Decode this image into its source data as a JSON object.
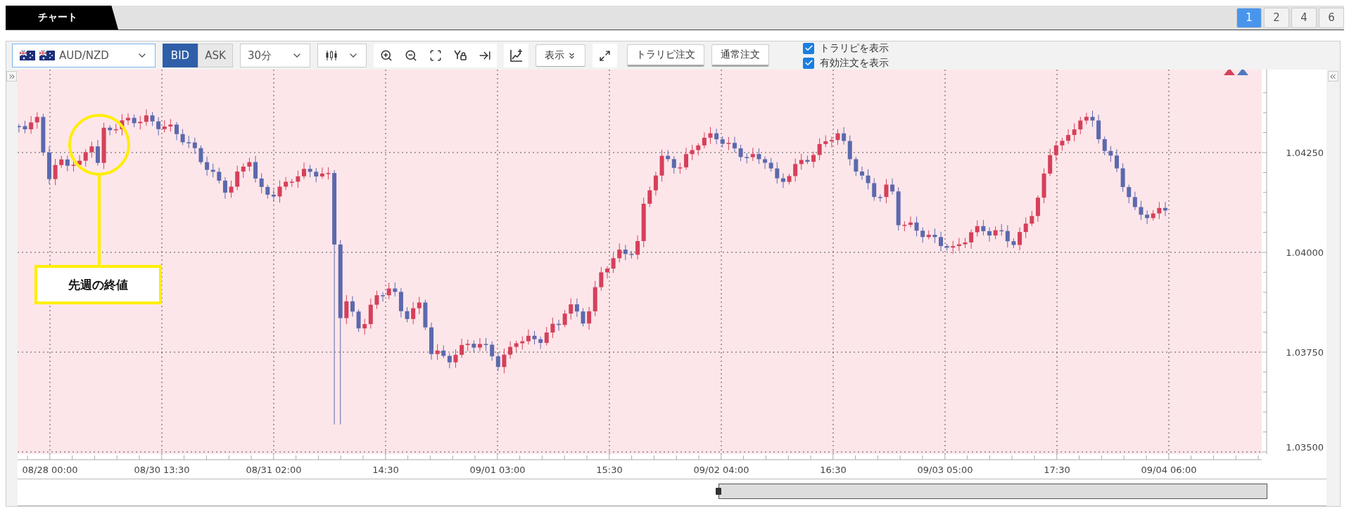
{
  "tabs": [
    {
      "label": "チャート",
      "selected": true
    }
  ],
  "layout_buttons": [
    {
      "label": "1",
      "selected": true
    },
    {
      "label": "2",
      "selected": false
    },
    {
      "label": "4",
      "selected": false
    },
    {
      "label": "6",
      "selected": false
    }
  ],
  "toolbar": {
    "currency_pair": "AUD/NZD",
    "price_types": [
      {
        "label": "BID",
        "selected": true
      },
      {
        "label": "ASK",
        "selected": false
      }
    ],
    "timeframe": "30分",
    "display_button": "表示",
    "order_buttons": [
      "トラリピ注文",
      "通常注文"
    ],
    "checkboxes": [
      {
        "label": "トラリピを表示",
        "checked": true
      },
      {
        "label": "有効注文を表示",
        "checked": true
      }
    ]
  },
  "chart": {
    "y_axis_labels": [
      "1.04250",
      "1.04000",
      "1.03750",
      "1.03500"
    ],
    "x_axis_labels": [
      "08/28 00:00",
      "08/30 13:30",
      "08/31 02:00",
      "14:30",
      "09/01 03:00",
      "15:30",
      "09/02 04:00",
      "16:30",
      "09/03 05:00",
      "17:30",
      "09/04 06:00"
    ],
    "callout": "先週の終値"
  }
}
